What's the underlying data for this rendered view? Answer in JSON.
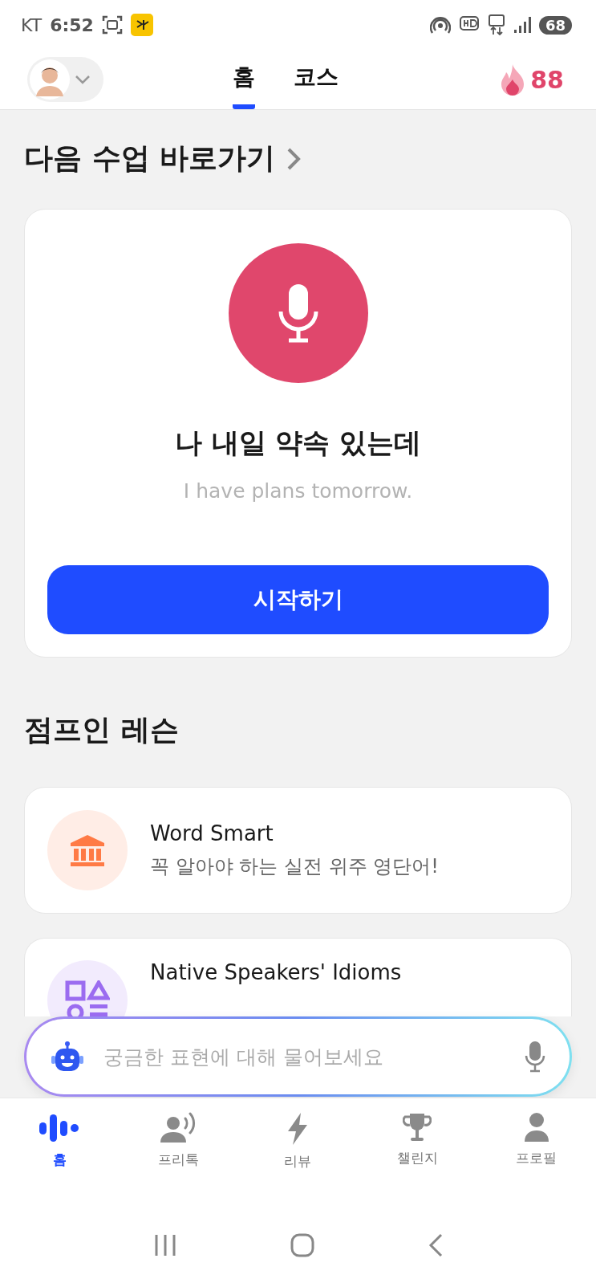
{
  "status_bar": {
    "carrier": "KT",
    "time": "6:52",
    "battery": "68"
  },
  "header": {
    "tabs": [
      {
        "label": "홈",
        "selected": true
      },
      {
        "label": "코스",
        "selected": false
      }
    ],
    "streak": "88"
  },
  "next_lesson": {
    "title": "다음 수업 바로가기",
    "phrase": "나 내일 약속 있는데",
    "translation": "I have plans tomorrow.",
    "button": "시작하기"
  },
  "jump_in": {
    "title": "점프인 레슨",
    "lessons": [
      {
        "kind": "building",
        "title": "Word Smart",
        "subtitle": "꼭 알아야 하는 실전 위주 영단어!",
        "color": "#ff7a45"
      },
      {
        "kind": "shapes",
        "title": "Native Speakers' Idioms",
        "color": "#9b6cf0"
      }
    ]
  },
  "ask_bar": {
    "placeholder": "궁금한 표현에 대해 물어보세요"
  },
  "bottom_nav": [
    {
      "kind": "home",
      "label": "홈",
      "selected": true
    },
    {
      "kind": "talk",
      "label": "프리톡",
      "selected": false
    },
    {
      "kind": "review",
      "label": "리뷰",
      "selected": false
    },
    {
      "kind": "challenge",
      "label": "챌린지",
      "selected": false
    },
    {
      "kind": "profile",
      "label": "프로필",
      "selected": false
    }
  ]
}
